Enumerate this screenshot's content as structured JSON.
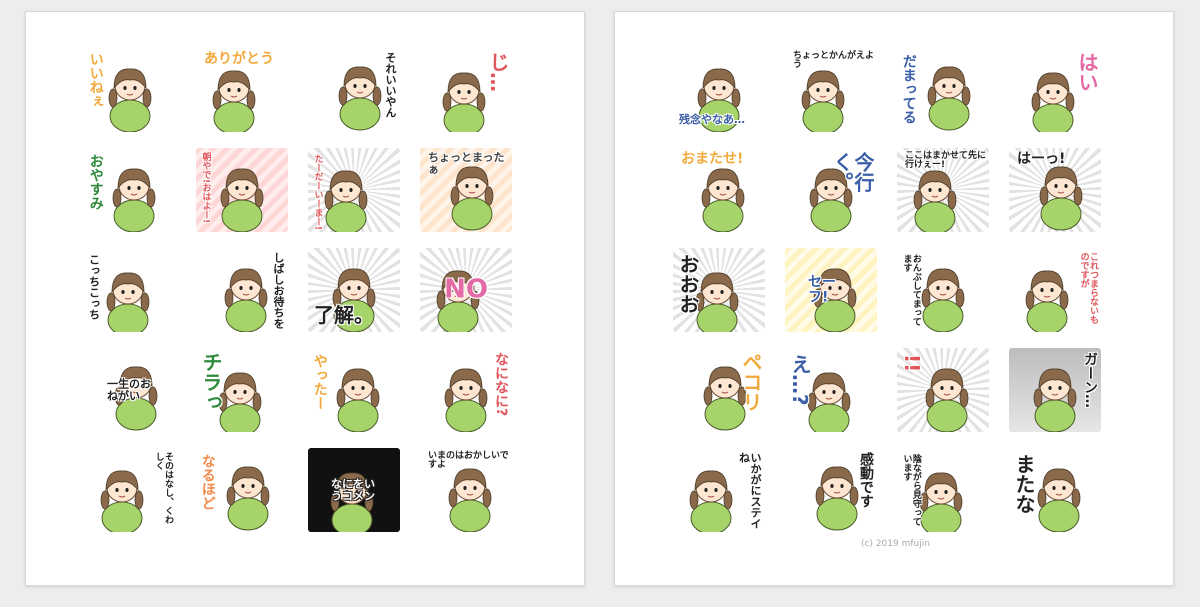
{
  "colors": {
    "page_bg": "#ededed",
    "panel_bg": "#ffffff",
    "hair": "#8a6a4a",
    "skin": "#fde6d2",
    "shirt": "#a6d36a",
    "pants": "#f2a93b"
  },
  "left_panel": {
    "stickers": [
      {
        "caption": "いいねぇ",
        "color": "#f2a93b",
        "bg": "plain",
        "pos": "tl"
      },
      {
        "caption": "ありがとう",
        "color": "#f2a93b",
        "bg": "plain",
        "pos": "top"
      },
      {
        "caption": "それいいやん",
        "color": "#222222",
        "bg": "plain",
        "pos": "right"
      },
      {
        "caption": "じ…",
        "color": "#e0565b",
        "bg": "plain",
        "pos": "right"
      },
      {
        "caption": "おやすみ",
        "color": "#2f8a3c",
        "bg": "plain",
        "pos": "left"
      },
      {
        "caption": "朝やで!おはよー!",
        "color": "#e0565b",
        "bg": "pink",
        "pos": "split"
      },
      {
        "caption": "たーだーいーまー!",
        "color": "#e0565b",
        "bg": "burst",
        "pos": "left"
      },
      {
        "caption": "ちょっとまったぁ",
        "color": "#444444",
        "bg": "orange",
        "pos": "top"
      },
      {
        "caption": "こっちこっち",
        "color": "#222222",
        "bg": "plain",
        "pos": "left"
      },
      {
        "caption": "しばしお待ちを",
        "color": "#222222",
        "bg": "plain",
        "pos": "right"
      },
      {
        "caption": "了解。",
        "color": "#222222",
        "bg": "burst",
        "pos": "bottom"
      },
      {
        "caption": "NO",
        "color": "#e46aa6",
        "bg": "burst",
        "pos": "center"
      },
      {
        "caption": "一生のおねがい",
        "color": "#222222",
        "bg": "plain",
        "pos": "center"
      },
      {
        "caption": "チラっ",
        "color": "#2f8a3c",
        "bg": "plain",
        "pos": "tl"
      },
      {
        "caption": "やったー",
        "color": "#f2a93b",
        "bg": "plain",
        "pos": "left"
      },
      {
        "caption": "なになに?",
        "color": "#e0565b",
        "bg": "plain",
        "pos": "right"
      },
      {
        "caption": "そのはなし、くわしく",
        "color": "#222222",
        "bg": "plain",
        "pos": "right"
      },
      {
        "caption": "なるほど",
        "color": "#f28a4b",
        "bg": "plain",
        "pos": "left"
      },
      {
        "caption": "なにをいうコメン",
        "color": "#ffffff",
        "bg": "black",
        "pos": "center"
      },
      {
        "caption": "いまのはおかしいですよ",
        "color": "#222222",
        "bg": "plain",
        "pos": "top"
      }
    ]
  },
  "right_panel": {
    "stickers": [
      {
        "caption": "残念やなあ…",
        "color": "#3b5fa8",
        "bg": "plain",
        "pos": "bottom"
      },
      {
        "caption": "ちょっとかんがえよう",
        "color": "#222222",
        "bg": "plain",
        "pos": "top"
      },
      {
        "caption": "だまってる",
        "color": "#3b5fa8",
        "bg": "plain",
        "pos": "left"
      },
      {
        "caption": "はい",
        "color": "#e46aa6",
        "bg": "plain",
        "pos": "right"
      },
      {
        "caption": "おまたせ!",
        "color": "#f2a93b",
        "bg": "plain",
        "pos": "top"
      },
      {
        "caption": "今行く。",
        "color": "#3b5fa8",
        "bg": "plain",
        "pos": "right"
      },
      {
        "caption": "ここはまかせて先に行けぇー!",
        "color": "#222222",
        "bg": "burst",
        "pos": "top"
      },
      {
        "caption": "はーっ!",
        "color": "#222222",
        "bg": "burst",
        "pos": "top"
      },
      {
        "caption": "おおお",
        "color": "#222222",
        "bg": "burst",
        "pos": "left"
      },
      {
        "caption": "セーフ!",
        "color": "#3b5fa8",
        "bg": "yellow",
        "pos": "center"
      },
      {
        "caption": "おんぶしてまってます",
        "color": "#222222",
        "bg": "plain",
        "pos": "left"
      },
      {
        "caption": "これつまらないものですが",
        "color": "#e0565b",
        "bg": "plain",
        "pos": "right"
      },
      {
        "caption": "ペコリ",
        "color": "#f2a93b",
        "bg": "plain",
        "pos": "right"
      },
      {
        "caption": "え…?",
        "color": "#3b5fa8",
        "bg": "plain",
        "pos": "left"
      },
      {
        "caption": "!!",
        "color": "#e0565b",
        "bg": "burst",
        "pos": "left"
      },
      {
        "caption": "ガーン…",
        "color": "#222222",
        "bg": "gray",
        "pos": "right"
      },
      {
        "caption": "いかがにステイね",
        "color": "#222222",
        "bg": "plain",
        "pos": "right"
      },
      {
        "caption": "感動です",
        "color": "#222222",
        "bg": "plain",
        "pos": "right"
      },
      {
        "caption": "陰ながら見守っています",
        "color": "#222222",
        "bg": "plain",
        "pos": "left"
      },
      {
        "caption": "またな",
        "color": "#222222",
        "bg": "plain",
        "pos": "left"
      }
    ],
    "credit": "(c) 2019 mfujin"
  }
}
